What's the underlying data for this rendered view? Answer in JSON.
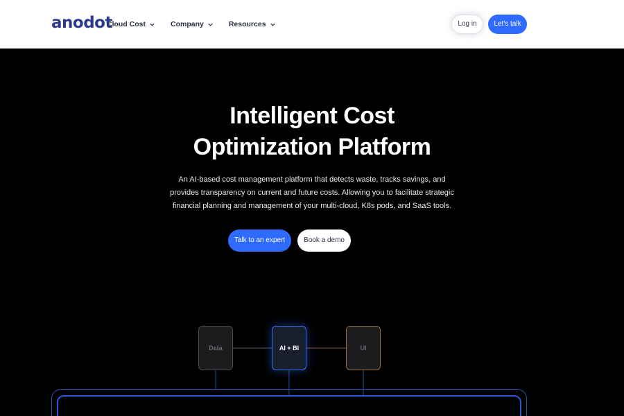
{
  "header": {
    "logo": "anodot",
    "nav": [
      {
        "label": "Cloud Cost"
      },
      {
        "label": "Company"
      },
      {
        "label": "Resources"
      }
    ],
    "login_label": "Log in",
    "talk_label": "Let's talk"
  },
  "hero": {
    "title_line1": "Intelligent Cost",
    "title_line2": "Optimization Platform",
    "subtitle_line1": "An AI-based cost management platform that detects waste, tracks savings, and",
    "subtitle_line2": "provides transparency on current and future costs. Allowing you to facilitate strategic",
    "subtitle_line3": "financial planning and management of your multi-cloud, K8s pods, and SaaS tools.",
    "primary_cta": "Talk to an expert",
    "secondary_cta": "Book a demo"
  },
  "diagram": {
    "nodes": [
      "Data",
      "AI + BI",
      "UI"
    ]
  },
  "colors": {
    "accent": "#2f6bff",
    "brand": "#2c3a8c",
    "background": "#000000"
  }
}
